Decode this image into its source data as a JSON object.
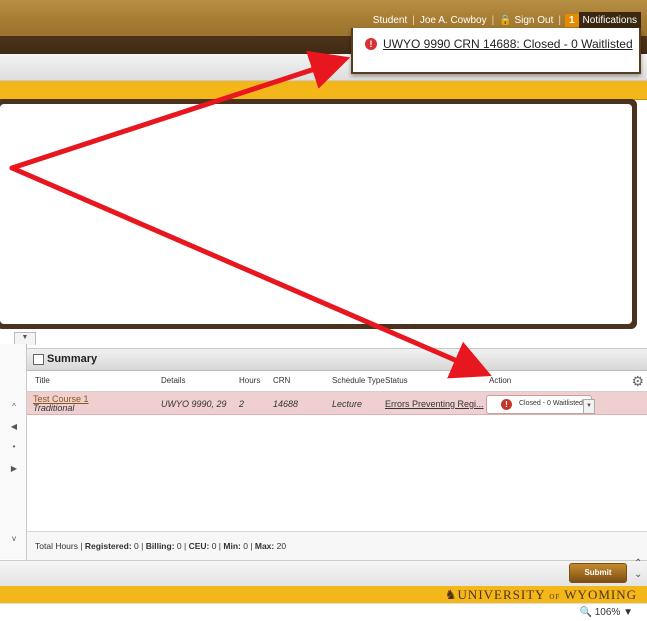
{
  "header": {
    "user_links": {
      "role": "Student",
      "user_name": "Joe A. Cowboy",
      "sign_out": "Sign Out",
      "notification_count": "1",
      "notifications": "Notifications"
    }
  },
  "notification_popup": {
    "message": "UWYO 9990 CRN 14688: Closed - 0 Waitlisted"
  },
  "summary": {
    "title": "Summary",
    "columns": [
      "Title",
      "Details",
      "Hours",
      "CRN",
      "Schedule Type",
      "Status",
      "Action"
    ],
    "rows": [
      {
        "title": "Test Course 1",
        "type": "Traditional",
        "details": "UWYO 9990, 29",
        "hours": "2",
        "crn": "14688",
        "schedule_type": "Lecture",
        "status": "Errors Preventing Regi...",
        "action": "Closed - 0 Waitlisted"
      }
    ],
    "totals": {
      "label_prefix": "Total Hours | ",
      "registered_label": "Registered:",
      "registered_value": " 0 | ",
      "billing_label": "Billing:",
      "billing_value": " 0 | ",
      "ceu_label": "CEU:",
      "ceu_value": " 0 | ",
      "min_label": "Min:",
      "min_value": " 0 | ",
      "max_label": "Max:",
      "max_value": " 20"
    }
  },
  "submit_label": "Submit",
  "footer": {
    "university": "UNIVERSITY",
    "of": "OF",
    "state": "WYOMING"
  },
  "statusbar": {
    "zoom": "106%"
  },
  "colors": {
    "brown": "#4b321c",
    "gold": "#f3b719",
    "annotation_red": "#e8161f",
    "error_row": "#efcfcf"
  }
}
